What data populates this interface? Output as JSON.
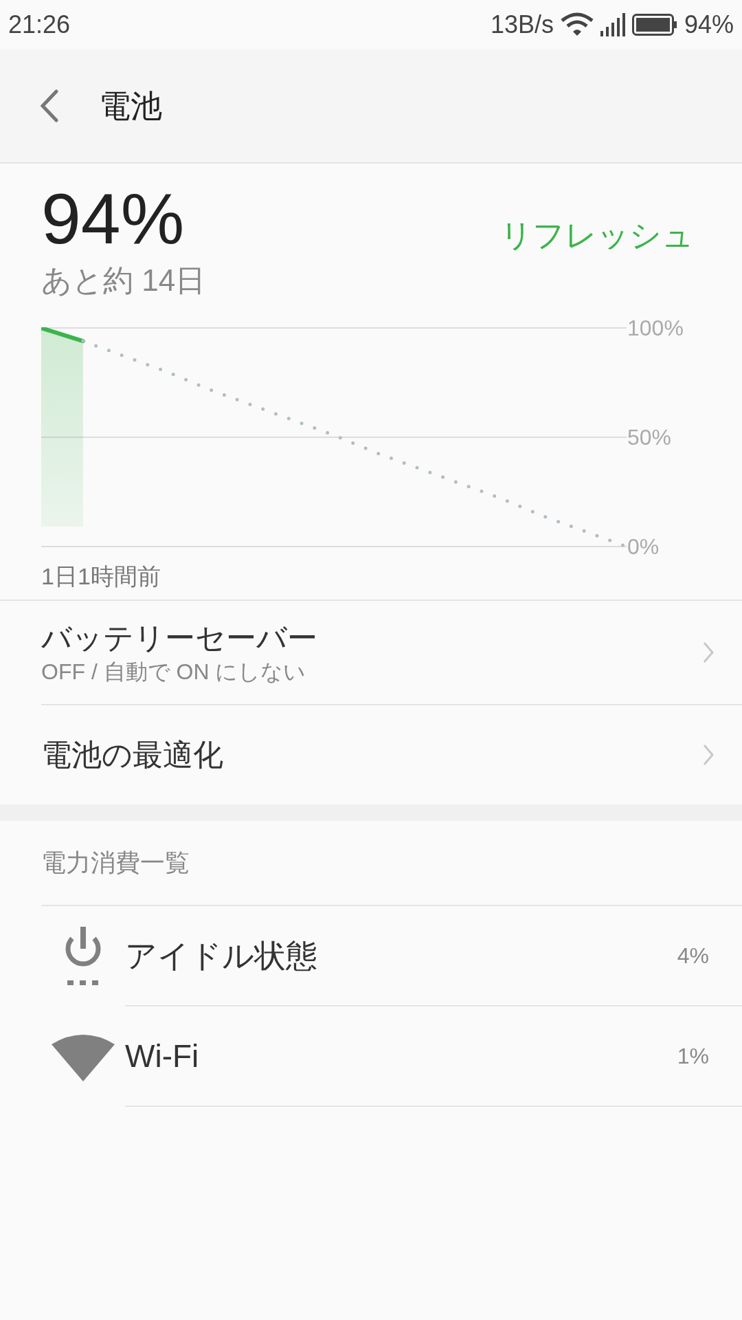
{
  "status_bar": {
    "time": "21:26",
    "network_speed": "13B/s",
    "battery": "94%"
  },
  "header": {
    "title": "電池"
  },
  "summary": {
    "level_text": "94%",
    "refresh": "リフレッシュ",
    "remaining": "あと約 14日"
  },
  "chart": {
    "chart_data": {
      "type": "line",
      "ylim": [
        0,
        100
      ],
      "series": [
        {
          "color": "#3cb44b",
          "values": [
            100,
            94,
            null,
            null,
            null,
            null,
            null,
            null,
            null,
            null,
            null,
            null,
            null,
            null,
            null
          ]
        },
        {
          "color": "#b0bec5",
          "line_style": "dotted",
          "values": [
            null,
            94,
            87,
            80,
            72,
            65,
            58,
            51,
            43,
            36,
            29,
            22,
            14,
            7,
            0
          ]
        }
      ],
      "annotations": [
        "1日1時間前"
      ],
      "yticks": [
        {
          "value": 100,
          "label": "100%"
        },
        {
          "value": 50,
          "label": "50%"
        },
        {
          "value": 0,
          "label": "0%"
        }
      ]
    }
  },
  "settings": [
    {
      "title": "バッテリーセーバー",
      "subtitle": "OFF / 自動で ON にしない"
    },
    {
      "title": "電池の最適化"
    }
  ],
  "usage": {
    "heading": "電力消費一覧",
    "items": [
      {
        "kind": "idle",
        "name": "アイドル状態",
        "percent": "4%"
      },
      {
        "kind": "wifi",
        "name": "Wi-Fi",
        "percent": "1%"
      }
    ]
  }
}
